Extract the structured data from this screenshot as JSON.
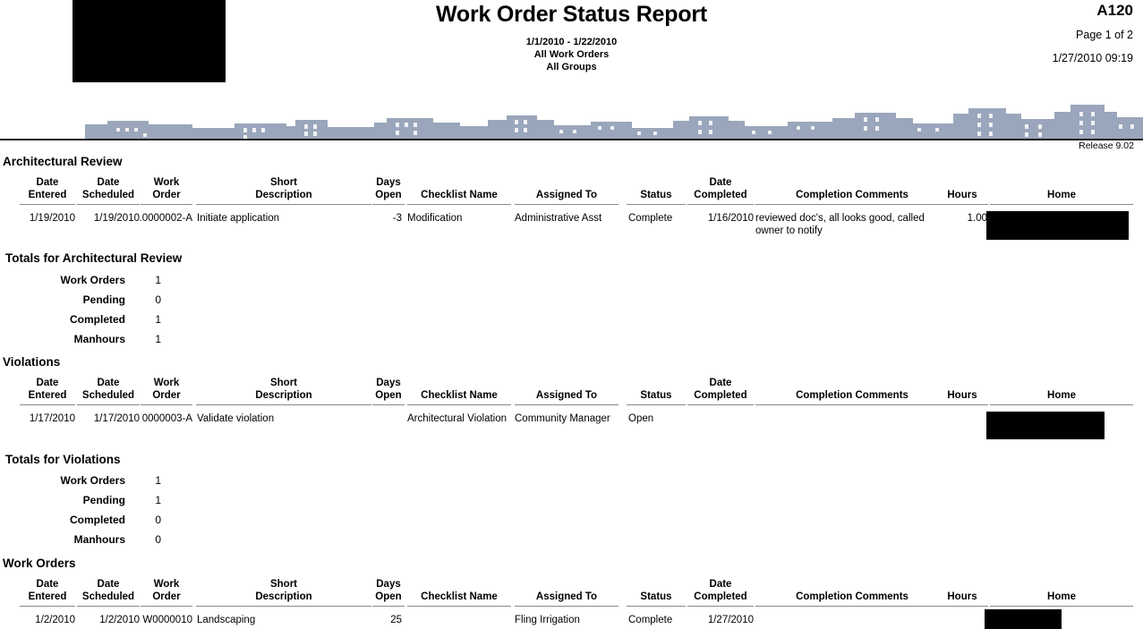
{
  "header": {
    "logo_redacted": "redacted-logo",
    "title": "Work Order Status Report",
    "date_range": "1/1/2010 - 1/22/2010",
    "scope_orders": "All Work Orders",
    "scope_groups": "All Groups",
    "report_code": "A120",
    "page_label": "Page 1 of 2",
    "printed_at": "1/27/2010 09:19",
    "release": "Release 9.02"
  },
  "columns": {
    "date_entered": {
      "line1": "Date",
      "line2": "Entered"
    },
    "date_scheduled": {
      "line1": "Date",
      "line2": "Scheduled"
    },
    "work_order": {
      "line1": "Work",
      "line2": "Order"
    },
    "short_description": {
      "line1": "Short",
      "line2": "Description"
    },
    "days_open": {
      "line1": "Days",
      "line2": "Open"
    },
    "checklist_name": {
      "line1": "",
      "line2": "Checklist Name"
    },
    "assigned_to": {
      "line1": "",
      "line2": "Assigned To"
    },
    "status": {
      "line1": "",
      "line2": "Status"
    },
    "date_completed": {
      "line1": "Date",
      "line2": "Completed"
    },
    "completion_comments": {
      "line1": "",
      "line2": "Completion Comments"
    },
    "hours": {
      "line1": "",
      "line2": "Hours"
    },
    "home": {
      "line1": "",
      "line2": "Home"
    }
  },
  "sections": {
    "architectural_review": {
      "heading": "Architectural Review",
      "row": {
        "date_entered": "1/19/2010",
        "date_scheduled": "1/19/2010",
        "work_order": ".0000002-A",
        "short_description": "Initiate application",
        "days_open": "-3",
        "checklist_name": "Modification",
        "assigned_to": "Administrative Asst",
        "status": "Complete",
        "date_completed": "1/16/2010",
        "completion_comments": "reviewed doc's, all looks good, called owner to notify",
        "hours": "1.00",
        "home": "redacted"
      },
      "totals": {
        "heading": "Totals for Architectural Review",
        "work_orders_label": "Work Orders",
        "work_orders_value": "1",
        "pending_label": "Pending",
        "pending_value": "0",
        "completed_label": "Completed",
        "completed_value": "1",
        "manhours_label": "Manhours",
        "manhours_value": "1"
      }
    },
    "violations": {
      "heading": "Violations",
      "row": {
        "date_entered": "1/17/2010",
        "date_scheduled": "1/17/2010",
        "work_order": "0000003-A",
        "short_description": "Validate violation",
        "days_open": "",
        "checklist_name": "Architectural Violation",
        "assigned_to": "Community Manager",
        "status": "Open",
        "date_completed": "",
        "completion_comments": "",
        "hours": "",
        "home": "redacted"
      },
      "totals": {
        "heading": "Totals for Violations",
        "work_orders_label": "Work Orders",
        "work_orders_value": "1",
        "pending_label": "Pending",
        "pending_value": "1",
        "completed_label": "Completed",
        "completed_value": "0",
        "manhours_label": "Manhours",
        "manhours_value": "0"
      }
    },
    "work_orders": {
      "heading": "Work Orders",
      "row": {
        "date_entered": "1/2/2010",
        "date_scheduled": "1/2/2010",
        "work_order": "W0000010",
        "short_description": "Landscaping",
        "days_open": "25",
        "checklist_name": "",
        "assigned_to": "Fling Irrigation",
        "status": "Complete",
        "date_completed": "1/27/2010",
        "completion_comments": "",
        "hours": "",
        "home": "redacted"
      }
    }
  }
}
